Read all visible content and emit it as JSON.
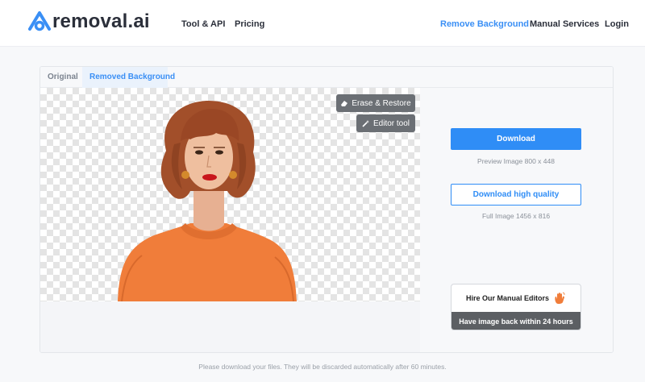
{
  "header": {
    "logo_text": "removal.ai",
    "nav": {
      "tool_api": "Tool & API",
      "pricing": "Pricing",
      "remove_background": "Remove Background",
      "manual_services": "Manual Services",
      "login": "Login"
    }
  },
  "tabs": {
    "original": "Original",
    "removed_background": "Removed Background"
  },
  "editor": {
    "erase_restore": "Erase & Restore",
    "editor_tool": "Editor tool"
  },
  "download": {
    "primary_label": "Download",
    "preview_note": "Preview Image   800 x 448",
    "hq_label": "Download high quality",
    "full_note": "Full Image   1456 x 816"
  },
  "manual": {
    "hire_label": "Hire Our Manual Editors",
    "hire_icon": "waving-hand-icon",
    "turnaround": "Have image back within 24 hours"
  },
  "footer": {
    "note": "Please download your files. They will be discarded automatically after 60 minutes."
  },
  "colors": {
    "accent": "#2f8df6",
    "nav_active": "#3a8ff5",
    "logo_text": "#2b2f3a",
    "overlay_button": "#6b6f74",
    "sweater": "#f07d3a",
    "hair": "#a24f2a"
  }
}
